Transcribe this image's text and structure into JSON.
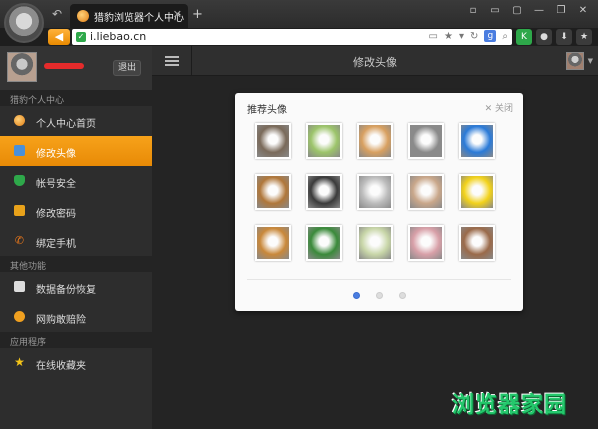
{
  "browser": {
    "tab_title": "猎豹浏览器个人中心",
    "tab_close": "✕",
    "new_tab": "+",
    "url": "i.liebao.cn",
    "window_buttons": [
      "▫",
      "▭",
      "▢",
      "—",
      "❐",
      "✕"
    ]
  },
  "sidebar": {
    "logout_label": "退出",
    "sections": [
      {
        "title": "猎豹个人中心",
        "items": [
          {
            "label": "个人中心首页",
            "icon": "home-icon",
            "active": false
          },
          {
            "label": "修改头像",
            "icon": "user-icon",
            "active": true
          },
          {
            "label": "帐号安全",
            "icon": "shield-icon",
            "active": false
          },
          {
            "label": "修改密码",
            "icon": "lock-icon",
            "active": false
          },
          {
            "label": "绑定手机",
            "icon": "phone-icon",
            "active": false
          }
        ]
      },
      {
        "title": "其他功能",
        "items": [
          {
            "label": "数据备份恢复",
            "icon": "backup-icon",
            "active": false
          },
          {
            "label": "网购敢赔险",
            "icon": "coin-icon",
            "active": false
          }
        ]
      },
      {
        "title": "应用程序",
        "items": [
          {
            "label": "在线收藏夹",
            "icon": "star-icon",
            "active": false
          }
        ]
      }
    ]
  },
  "main": {
    "page_title": "修改头像"
  },
  "dialog": {
    "title": "推荐头像",
    "close_label": "✕ 关闭",
    "avatars": [
      {
        "name": "monkey",
        "color": "#7a6a5a"
      },
      {
        "name": "frog",
        "color": "#9cc46a"
      },
      {
        "name": "girl-hat",
        "color": "#d8a060"
      },
      {
        "name": "bw-figure",
        "color": "#8a8a8a"
      },
      {
        "name": "doraemon",
        "color": "#2a7ad8"
      },
      {
        "name": "camel",
        "color": "#b0773a"
      },
      {
        "name": "man-portrait",
        "color": "#3a3a3a"
      },
      {
        "name": "bw-woman",
        "color": "#bcbcbc"
      },
      {
        "name": "girl-bun",
        "color": "#c9a78a"
      },
      {
        "name": "spongebob",
        "color": "#f2d21a"
      },
      {
        "name": "tiger",
        "color": "#c9883a"
      },
      {
        "name": "green-monster",
        "color": "#3a8a3a"
      },
      {
        "name": "bottle",
        "color": "#c8d6a8"
      },
      {
        "name": "flower",
        "color": "#d8a0a8"
      },
      {
        "name": "brunette-girl",
        "color": "#9a6a4a"
      }
    ],
    "page_count": 3,
    "active_page": 1
  },
  "watermark": "浏览器家园",
  "colors": {
    "accent": "#f39a12",
    "page_dot_active": "#4a7de0",
    "watermark": "#24c86c"
  }
}
